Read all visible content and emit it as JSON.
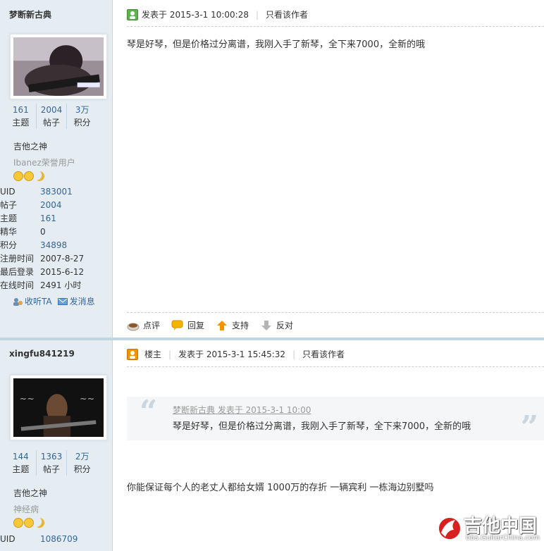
{
  "posts": [
    {
      "author": "梦断新古典",
      "stats": [
        {
          "value": "161",
          "label": "主题"
        },
        {
          "value": "2004",
          "label": "帖子"
        },
        {
          "value": "3万",
          "label": "积分"
        }
      ],
      "rank": "吉他之神",
      "group_title": "Ibanez荣誉用户",
      "info": [
        {
          "key": "UID",
          "value": "383001",
          "link": true
        },
        {
          "key": "帖子",
          "value": "2004",
          "link": true
        },
        {
          "key": "主题",
          "value": "161",
          "link": true
        },
        {
          "key": "精华",
          "value": "0",
          "link": false
        },
        {
          "key": "积分",
          "value": "34898",
          "link": true
        },
        {
          "key": "注册时间",
          "value": "2007-8-27",
          "link": false
        },
        {
          "key": "最后登录",
          "value": "2015-6-12",
          "link": false
        },
        {
          "key": "在线时间",
          "value": "2491 小时",
          "link": false
        }
      ],
      "actions": {
        "follow": "收听TA",
        "message": "发消息"
      },
      "header": {
        "posted": "发表于 2015-3-1 10:00:28",
        "only_author": "只看该作者"
      },
      "content": "琴是好琴，但是价格过分离谱，我刚入手了新琴，全下来7000，全新的哦",
      "footer": {
        "comment": "点评",
        "reply": "回复",
        "support": "支持",
        "oppose": "反对"
      }
    },
    {
      "author": "xingfu841219",
      "stats": [
        {
          "value": "144",
          "label": "主题"
        },
        {
          "value": "1363",
          "label": "帖子"
        },
        {
          "value": "2万",
          "label": "积分"
        }
      ],
      "rank": "吉他之神",
      "group_title": "神经病",
      "info": [
        {
          "key": "UID",
          "value": "1086709",
          "link": true
        }
      ],
      "header": {
        "owner": "楼主",
        "posted": "发表于 2015-3-1 15:45:32",
        "only_author": "只看该作者"
      },
      "quote": {
        "head": "梦断新古典 发表于 2015-3-1 10:00",
        "body": "琴是好琴，但是价格过分离谱，我刚入手了新琴，全下来7000，全新的哦"
      },
      "content": "你能保证每个人的老丈人都给女婿 1000万的存折 一辆宾利 一栋海边别墅吗"
    }
  ],
  "watermark": {
    "title": "吉他中国",
    "url": "bbs.GuitarChina.com"
  }
}
